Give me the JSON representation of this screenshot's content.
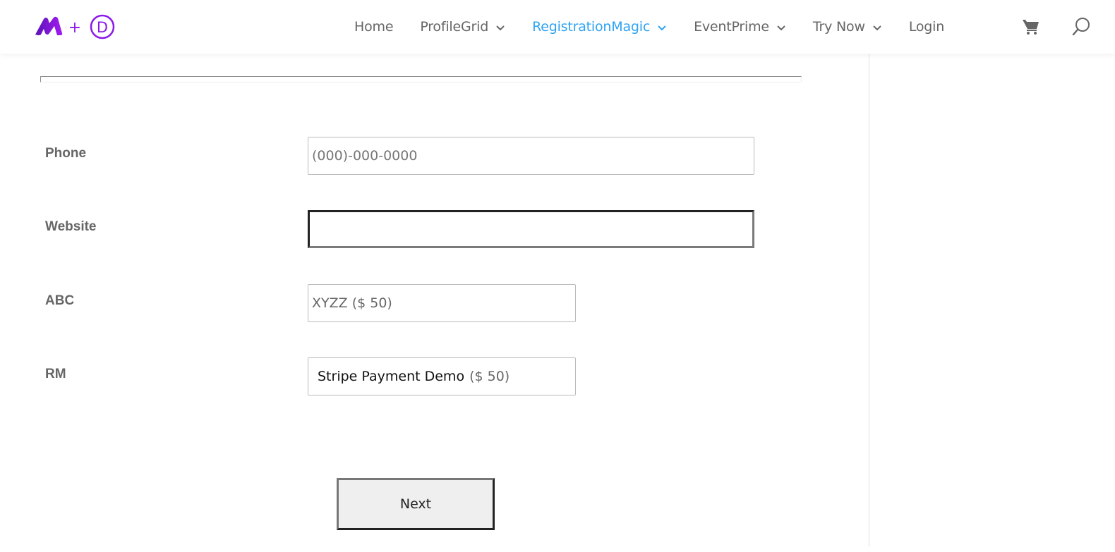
{
  "brand": {
    "logo_icon": "magic-plus-divi-logo",
    "accent_color": "#8b1ae8",
    "plus": "+",
    "letter": "D"
  },
  "nav": {
    "items": [
      {
        "label": "Home",
        "has_dropdown": false,
        "active": false
      },
      {
        "label": "ProfileGrid",
        "has_dropdown": true,
        "active": false
      },
      {
        "label": "RegistrationMagic",
        "has_dropdown": true,
        "active": true
      },
      {
        "label": "EventPrime",
        "has_dropdown": true,
        "active": false
      },
      {
        "label": "Try Now",
        "has_dropdown": true,
        "active": false
      },
      {
        "label": "Login",
        "has_dropdown": false,
        "active": false
      }
    ],
    "active_color": "#2ea3f2",
    "text_color": "#666666",
    "cart_icon": "cart-icon",
    "search_icon": "search-icon"
  },
  "form": {
    "fields": [
      {
        "label": "Phone",
        "value": "",
        "placeholder": "(000)-000-0000"
      },
      {
        "label": "Website",
        "value": "",
        "placeholder": ""
      },
      {
        "label": "ABC",
        "value": "XYZZ ($ 50)"
      },
      {
        "label": "RM",
        "product": "Stripe Payment Demo",
        "price": "($ 50)"
      }
    ],
    "next_label": "Next"
  }
}
